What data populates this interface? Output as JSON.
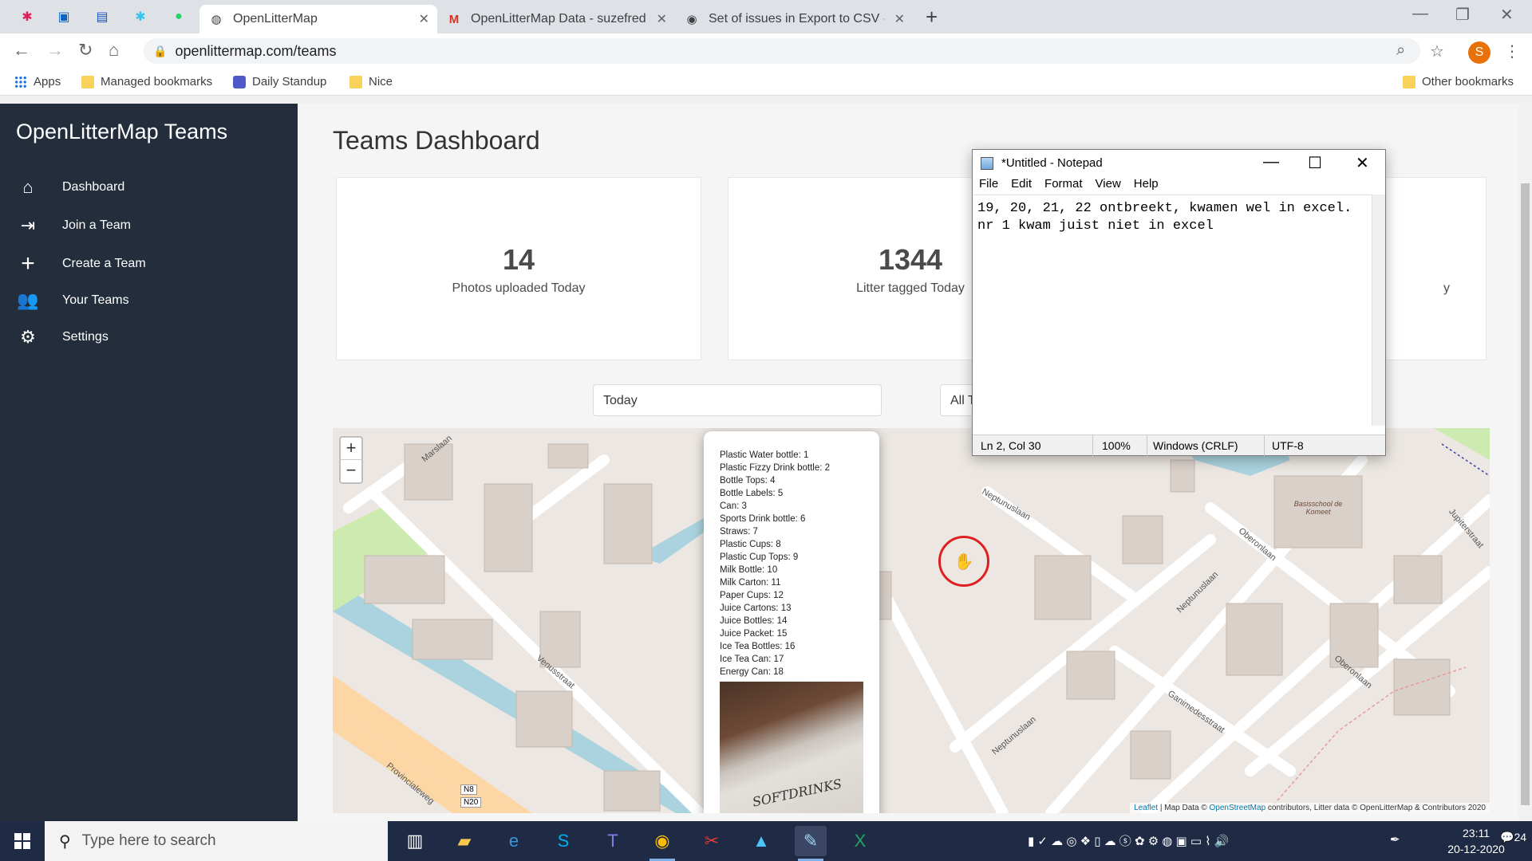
{
  "browser": {
    "tabs": [
      {
        "label": "OpenLitterMap",
        "icon": "globe-icon"
      },
      {
        "label": "OpenLitterMap Data - suzefred@",
        "icon": "gmail-icon"
      },
      {
        "label": "Set of issues in Export to CSV - Is",
        "icon": "github-icon"
      }
    ],
    "new_tab": "+",
    "url": "openlittermap.com/teams",
    "bookmarks": [
      "Apps",
      "Managed bookmarks",
      "Daily Standup",
      "Nice"
    ],
    "other_bookmarks": "Other bookmarks",
    "profile_initial": "S"
  },
  "sidebar": {
    "title": "OpenLitterMap Teams",
    "items": [
      {
        "label": "Dashboard",
        "icon": "home-icon"
      },
      {
        "label": "Join a Team",
        "icon": "sign-in-icon"
      },
      {
        "label": "Create a Team",
        "icon": "plus-icon"
      },
      {
        "label": "Your Teams",
        "icon": "users-icon"
      },
      {
        "label": "Settings",
        "icon": "gear-icon"
      }
    ]
  },
  "main": {
    "title": "Teams Dashboard",
    "cards": [
      {
        "value": "14",
        "label": "Photos uploaded Today"
      },
      {
        "value": "1344",
        "label": "Litter tagged Today"
      },
      {
        "value": "",
        "label": "y"
      }
    ],
    "period_select": "Today",
    "team_select": "All T"
  },
  "map": {
    "zoom_in": "+",
    "zoom_out": "−",
    "popup_items": [
      "Plastic Water bottle: 1",
      "Plastic Fizzy Drink bottle: 2",
      "Bottle Tops: 4",
      "Bottle Labels: 5",
      "Can: 3",
      "Sports Drink bottle: 6",
      "Straws: 7",
      "Plastic Cups: 8",
      "Plastic Cup Tops: 9",
      "Milk Bottle: 10",
      "Milk Carton: 11",
      "Paper Cups: 12",
      "Juice Cartons: 13",
      "Juice Bottles: 14",
      "Juice Packet: 15",
      "Ice Tea Bottles: 16",
      "Ice Tea Can: 17",
      "Energy Can: 18"
    ],
    "photo_text": "SOFTDRINKS",
    "streets": [
      "Marslaan",
      "Venusstraat",
      "Neptunuslaan",
      "Neptunuslaan",
      "Oberonlaan",
      "Oberonlaan",
      "Ganimedesstraat",
      "Jupiterstraat",
      "Provincialeweg",
      "Neptunuslaan"
    ],
    "landmark": "Basisschool de Komeet",
    "road_badges": [
      "N8",
      "N20"
    ],
    "attribution": {
      "leaflet": "Leaflet",
      "mid": " | Map Data © ",
      "osm": "OpenStreetMap",
      "tail": " contributors, Litter data © OpenLitterMap & Contributors 2020"
    }
  },
  "notepad": {
    "title": "*Untitled - Notepad",
    "menu": [
      "File",
      "Edit",
      "Format",
      "View",
      "Help"
    ],
    "text": "19, 20, 21, 22 ontbreekt, kwamen wel in excel.\nnr 1 kwam juist niet in excel",
    "status": {
      "position": "Ln 2, Col 30",
      "zoom": "100%",
      "line_ending": "Windows (CRLF)",
      "encoding": "UTF-8"
    }
  },
  "taskbar": {
    "search_placeholder": "Type here to search",
    "time": "23:11",
    "date": "20-12-2020",
    "notifications": "24"
  }
}
